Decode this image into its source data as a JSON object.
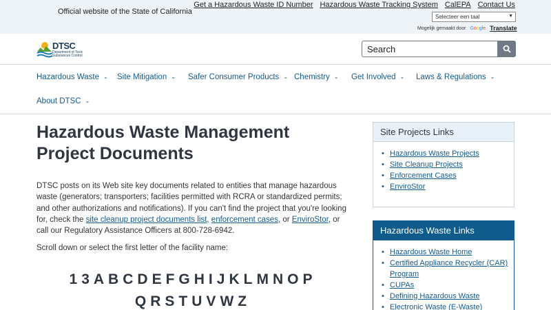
{
  "utility": {
    "official_text": "Official website of the State of California",
    "links": [
      "Get a Hazardous Waste ID Number",
      "Hazardous Waste Tracking System",
      "CalEPA",
      "Contact Us"
    ],
    "language_select": "Selecteer een taal",
    "powered_by": "Mogelijk gemaakt door",
    "google_text": "Google",
    "translate_label": "Translate"
  },
  "header": {
    "logo_text": "DTSC",
    "logo_sub": "Department of Toxic Substances Control",
    "search_value": "Search",
    "search_icon": "search-icon"
  },
  "nav": {
    "items": [
      "Hazardous Waste",
      "Site Mitigation",
      "Safer Consumer Products",
      "Chemistry",
      "Get Involved",
      "Laws & Regulations",
      "About DTSC"
    ],
    "chevron": "⌄"
  },
  "main": {
    "title": "Hazardous Waste Management Project Documents",
    "intro_1": "DTSC posts on its Web site key documents related to entities that manage hazardous waste (generators; transporters; facilities permitted with RCRA or standardized permits; and other authorizations and notifications). If you can't find the project that you're looking for, check the ",
    "link_1": "site cleanup project documents list",
    "sep_1": ", ",
    "link_2": "enforcement cases",
    "sep_2": ", or ",
    "link_3": "EnviroStor",
    "intro_2": ", or call our Regulatory Assistance Officers at 800-728-6942.",
    "scroll_text": "Scroll down or select the first letter of the facility name:",
    "letters": [
      "1",
      "3",
      "A",
      "B",
      "C",
      "D",
      "E",
      "F",
      "G",
      "H",
      "I",
      "J",
      "K",
      "L",
      "M",
      "N",
      "O",
      "P",
      "Q",
      "R",
      "S",
      "T",
      "U",
      "V",
      "W",
      "Z"
    ]
  },
  "sidebar": {
    "card1": {
      "title": "Site Projects Links",
      "links": [
        "Hazardous Waste Projects",
        "Site Cleanup Projects",
        "Enforcement Cases",
        "EnviroStor"
      ]
    },
    "card2": {
      "title": "Hazardous Waste Links",
      "links": [
        "Hazardous Waste Home",
        "Certified Appliance Recycler (CAR) Program",
        "CUPAs",
        "Defining Hazardous Waste",
        "Electronic Waste (E-Waste)"
      ]
    }
  },
  "colors": {
    "accent": "#0f5c8c",
    "link": "#145a8a",
    "util_bg": "#eef3f8"
  }
}
